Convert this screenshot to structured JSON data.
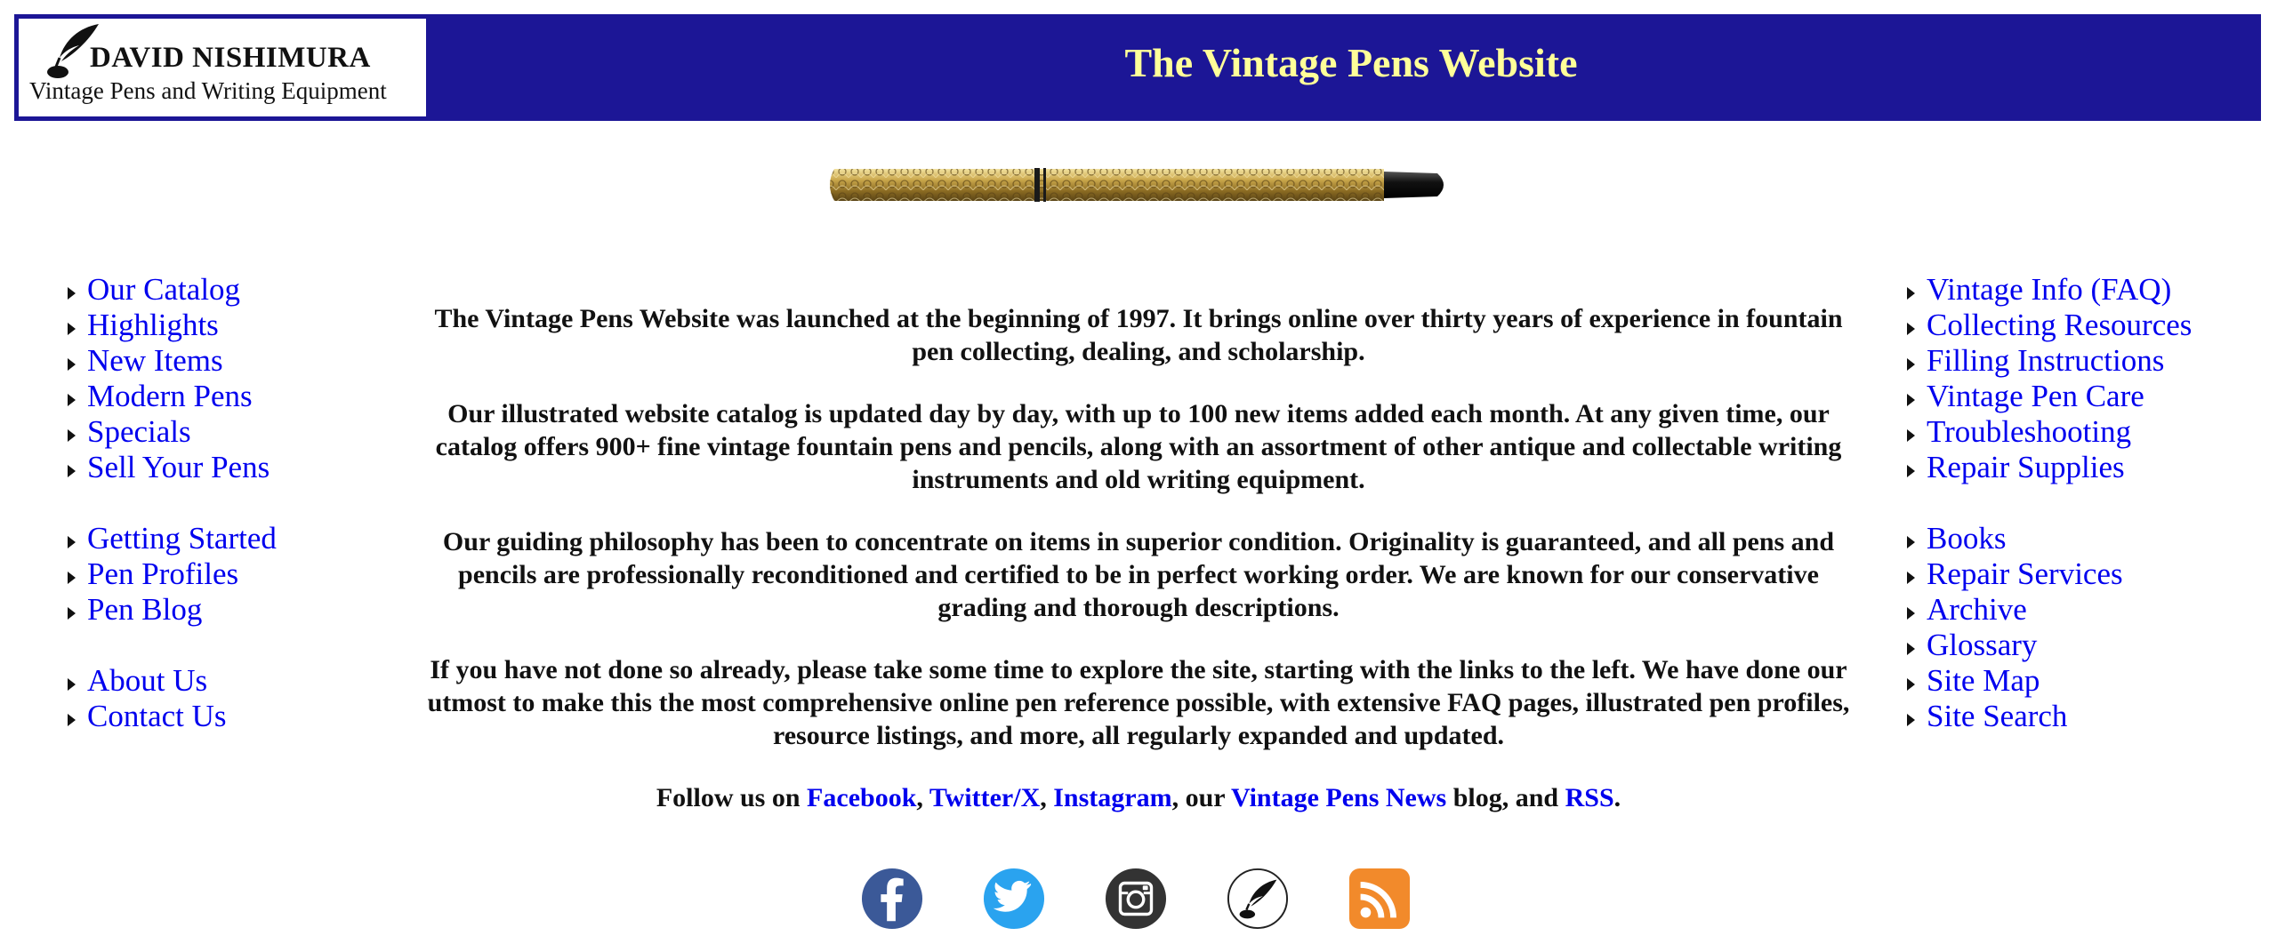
{
  "header": {
    "logo_name": "DAVID NISHIMURA",
    "logo_tagline": "Vintage Pens and Writing Equipment",
    "site_title": "The Vintage Pens Website",
    "bg_color": "#1c1696",
    "title_color": "#ffff99"
  },
  "nav_left": {
    "group1": [
      "Our Catalog",
      "Highlights",
      "New Items",
      "Modern Pens",
      "Specials",
      "Sell Your Pens"
    ],
    "group2": [
      "Getting Started",
      "Pen Profiles",
      "Pen Blog"
    ],
    "group3": [
      "About Us",
      "Contact Us"
    ]
  },
  "nav_right": {
    "group1": [
      "Vintage Info (FAQ)",
      "Collecting Resources",
      "Filling Instructions",
      "Vintage Pen Care",
      "Troubleshooting",
      "Repair Supplies"
    ],
    "group2": [
      "Books",
      "Repair Services",
      "Archive",
      "Glossary",
      "Site Map",
      "Site Search"
    ]
  },
  "main": {
    "p1": "The Vintage Pens Website was launched at the beginning of 1997. It brings online over thirty years of experience in fountain pen collecting, dealing, and scholarship.",
    "p2": "Our illustrated website catalog is updated day by day, with up to 100 new items added each month. At any given time, our catalog offers 900+ fine vintage fountain pens and pencils, along with an assortment of other antique and collectable writing instruments and old writing equipment.",
    "p3": "Our guiding philosophy has been to concentrate on items in superior condition. Originality is guaranteed, and all pens and pencils are professionally reconditioned and certified to be in perfect working order. We are known for our conservative grading and thorough descriptions.",
    "p4": "If you have not done so already, please take some time to explore the site, starting with the links to the left.  We have done our utmost to make this the most comprehensive online pen reference possible, with extensive FAQ pages, illustrated pen profiles, resource listings, and more, all regularly expanded and updated.",
    "follow": {
      "prefix": "Follow us on ",
      "facebook": "Facebook",
      "sep1": ", ",
      "twitter": "Twitter/X",
      "sep2": ", ",
      "instagram": "Instagram",
      "sep3": ", our ",
      "news": "Vintage Pens News",
      "sep4": " blog, and ",
      "rss": "RSS",
      "suffix": "."
    }
  },
  "social_icons": [
    {
      "name": "facebook-icon",
      "color": "#3b5998"
    },
    {
      "name": "twitter-icon",
      "color": "#2aa3ef"
    },
    {
      "name": "instagram-icon",
      "color": "#333333"
    },
    {
      "name": "blog-quill-icon",
      "color": "#ffffff"
    },
    {
      "name": "rss-icon",
      "color": "#f28a2b"
    }
  ]
}
